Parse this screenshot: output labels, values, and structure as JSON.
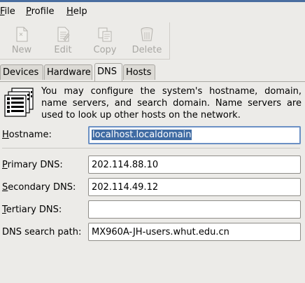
{
  "menubar": {
    "items": [
      {
        "label": "File",
        "mnemonic": "F",
        "rest": "ile"
      },
      {
        "label": "Profile",
        "mnemonic": "P",
        "rest": "rofile"
      },
      {
        "label": "Help",
        "mnemonic": "H",
        "rest": "elp"
      }
    ]
  },
  "toolbar": {
    "new_label": "New",
    "edit_label": "Edit",
    "copy_label": "Copy",
    "delete_label": "Delete",
    "icons": [
      "new-document-icon",
      "edit-document-icon",
      "copy-icon",
      "trash-can-icon"
    ],
    "disabled": true
  },
  "tabs": [
    {
      "label": "Devices"
    },
    {
      "label": "Hardware"
    },
    {
      "label": "DNS",
      "selected": true
    },
    {
      "label": "Hosts"
    }
  ],
  "info": {
    "icon": "network-hosts-icon",
    "text": "You may configure the system's hostname, domain, name servers, and search domain. Name servers are used to look up other hosts on the network."
  },
  "form": {
    "hostname_label": "Hostname:",
    "hostname_value": "localhost.localdomain",
    "primary_label": "Primary DNS:",
    "primary_value": "202.114.88.10",
    "secondary_label": "Secondary DNS:",
    "secondary_value": "202.114.49.12",
    "tertiary_label": "Tertiary DNS:",
    "tertiary_value": "",
    "search_label": "DNS search path:",
    "search_value": "MX960A-JH-users.whut.edu.cn"
  },
  "colors": {
    "window_bg": "#ecebe8",
    "selection": "#3f6ba3",
    "focus_border": "#6b90c4",
    "disabled_text": "#a8a7a3"
  }
}
